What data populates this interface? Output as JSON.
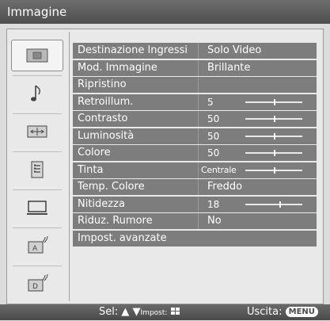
{
  "header": {
    "title": "Immagine"
  },
  "sidebar": {
    "items": [
      {
        "icon": "picture-icon",
        "selected": true
      },
      {
        "icon": "music-note-icon",
        "selected": false
      },
      {
        "icon": "screen-format-icon",
        "selected": false
      },
      {
        "icon": "settings-list-icon",
        "selected": false
      },
      {
        "icon": "monitor-icon",
        "selected": false
      },
      {
        "icon": "analog-antenna-icon",
        "selected": false
      },
      {
        "icon": "digital-antenna-icon",
        "selected": false
      }
    ]
  },
  "menu": {
    "rows": [
      {
        "label": "Destinazione Ingressi",
        "value": "Solo Video"
      },
      {
        "label": "Mod. Immagine",
        "value": "Brillante"
      },
      {
        "label": "Ripristino",
        "value": ""
      },
      {
        "label": "Retroillum.",
        "value": "5",
        "level": 0.5
      },
      {
        "label": "Contrasto",
        "value": "50",
        "level": 0.5
      },
      {
        "label": "Luminosità",
        "value": "50",
        "level": 0.5
      },
      {
        "label": "Colore",
        "value": "50",
        "level": 0.5
      },
      {
        "label": "Tinta",
        "value": "Centrale",
        "level": 0.5
      },
      {
        "label": "Temp. Colore",
        "value": "Freddo"
      },
      {
        "label": "Nitidezza",
        "value": "18",
        "level": 0.6
      },
      {
        "label": "Riduz. Rumore",
        "value": "No"
      },
      {
        "label": "Impost. avanzate",
        "value": ""
      }
    ]
  },
  "footer": {
    "select_label": "Sel:",
    "set_label": "Impost:",
    "exit_label": "Uscita:",
    "menu_key": "MENU"
  }
}
